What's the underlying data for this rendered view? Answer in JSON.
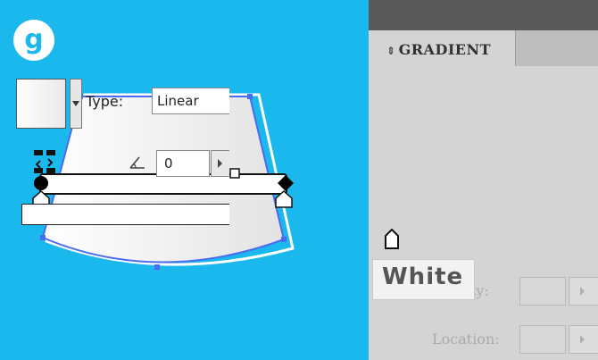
{
  "step": {
    "number": "g"
  },
  "panel": {
    "title": "GRADIENT",
    "type_label": "Type:",
    "type_value": "Linear",
    "angle_value": "0",
    "opacity_label": "Opacity:",
    "location_label": "Location:"
  },
  "tooltip": {
    "text": "White"
  },
  "colors": {
    "canvas_background": "#1ab8ec",
    "panel_background": "#d4d4d4",
    "selection_blue": "#4a6cf0"
  },
  "icons": [
    "reverse-gradient-icon",
    "angle-icon",
    "stepper-arrow-icon",
    "gradient-stop-icon",
    "dropdown-arrow-icon"
  ]
}
